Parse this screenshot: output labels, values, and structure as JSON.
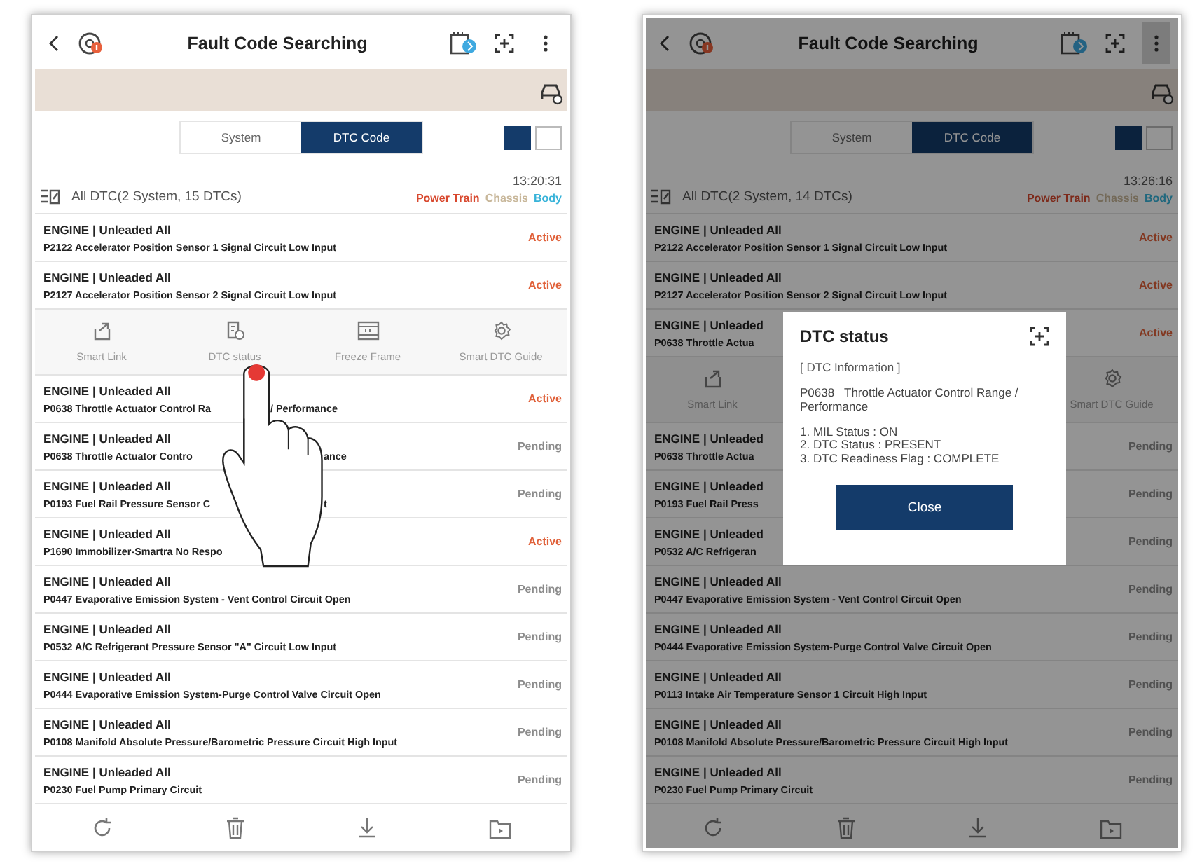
{
  "screens": [
    {
      "title": "Fault Code Searching",
      "menu_pressed": false,
      "tabs": [
        {
          "label": "System",
          "selected": false
        },
        {
          "label": "DTC Code",
          "selected": true
        }
      ],
      "view_toggle": [
        {
          "selected": true
        },
        {
          "selected": false
        }
      ],
      "summary": {
        "label": "All DTC(2 System, 15 DTCs)",
        "time": "13:20:31"
      },
      "categories": [
        {
          "label": "Power Train",
          "color": "#d8482e"
        },
        {
          "label": "Chassis",
          "color": "#c8b79a"
        },
        {
          "label": "Body",
          "color": "#38b3d9"
        }
      ],
      "list": [
        {
          "kind": "dtc",
          "heading": "ENGINE | Unleaded All",
          "description": [
            "P2122 Accelerator Position Sensor 1 Signal Circuit Low Input"
          ],
          "status": "Active",
          "active": true
        },
        {
          "kind": "dtc",
          "heading": "ENGINE | Unleaded All",
          "description": [
            "P2127 Accelerator Position Sensor 2 Signal Circuit Low Input"
          ],
          "status": "Active",
          "active": true
        },
        {
          "kind": "actions",
          "items": [
            {
              "kind": "smart_link",
              "label": "Smart Link"
            },
            {
              "kind": "dtc_status",
              "label": "DTC status"
            },
            {
              "kind": "freeze_frame",
              "label": "Freeze Frame"
            },
            {
              "kind": "guide",
              "label": "Smart DTC Guide"
            }
          ]
        },
        {
          "kind": "dtc",
          "heading": "ENGINE | Unleaded All",
          "description": [
            "P0638 Throttle Actuator Control Ra",
            "/ Performance"
          ],
          "status": "Active",
          "active": true
        },
        {
          "kind": "dtc",
          "heading": "ENGINE | Unleaded All",
          "description": [
            "P0638 Throttle Actuator Contro",
            "ance"
          ],
          "status": "Pending",
          "active": false
        },
        {
          "kind": "dtc",
          "heading": "ENGINE | Unleaded All",
          "description": [
            "P0193 Fuel Rail Pressure Sensor C",
            "t"
          ],
          "status": "Pending",
          "active": false
        },
        {
          "kind": "dtc",
          "heading": "ENGINE | Unleaded All",
          "description": [
            "P1690 Immobilizer-Smartra No Respo"
          ],
          "status": "Active",
          "active": true
        },
        {
          "kind": "dtc",
          "heading": "ENGINE | Unleaded All",
          "description": [
            "P0447 Evaporative Emission System - Vent Control Circuit Open"
          ],
          "status": "Pending",
          "active": false
        },
        {
          "kind": "dtc",
          "heading": "ENGINE | Unleaded All",
          "description": [
            "P0532 A/C Refrigerant Pressure Sensor \"A\" Circuit Low Input"
          ],
          "status": "Pending",
          "active": false
        },
        {
          "kind": "dtc",
          "heading": "ENGINE | Unleaded All",
          "description": [
            "P0444 Evaporative Emission System-Purge Control Valve Circuit Open"
          ],
          "status": "Pending",
          "active": false
        },
        {
          "kind": "dtc",
          "heading": "ENGINE | Unleaded All",
          "description": [
            "P0108 Manifold Absolute Pressure/Barometric Pressure Circuit High Input"
          ],
          "status": "Pending",
          "active": false
        },
        {
          "kind": "dtc",
          "heading": "ENGINE | Unleaded All",
          "description": [
            "P0230 Fuel Pump Primary Circuit"
          ],
          "status": "Pending",
          "active": false
        }
      ],
      "overlay": {
        "kind": "touch"
      }
    },
    {
      "title": "Fault Code Searching",
      "menu_pressed": true,
      "tabs": [
        {
          "label": "System",
          "selected": false
        },
        {
          "label": "DTC Code",
          "selected": true
        }
      ],
      "view_toggle": [
        {
          "selected": true
        },
        {
          "selected": false
        }
      ],
      "summary": {
        "label": "All DTC(2 System, 14 DTCs)",
        "time": "13:26:16"
      },
      "categories": [
        {
          "label": "Power Train",
          "color": "#7d2a1b"
        },
        {
          "label": "Chassis",
          "color": "#746a59"
        },
        {
          "label": "Body",
          "color": "#20687e"
        }
      ],
      "list": [
        {
          "kind": "dtc",
          "heading": "ENGINE | Unleaded All",
          "description": [
            "P2122 Accelerator Position Sensor 1 Signal Circuit Low Input"
          ],
          "status": "Active",
          "active": true
        },
        {
          "kind": "dtc",
          "heading": "ENGINE | Unleaded All",
          "description": [
            "P2127 Accelerator Position Sensor 2 Signal Circuit Low Input"
          ],
          "status": "Active",
          "active": true
        },
        {
          "kind": "dtc",
          "heading": "ENGINE | Unleaded",
          "description": [
            "P0638 Throttle Actua"
          ],
          "status": "Active",
          "active": true
        },
        {
          "kind": "actions",
          "items": [
            {
              "kind": "smart_link",
              "label": "Smart Link"
            },
            {
              "kind": "guide",
              "label": "Smart DTC Guide"
            }
          ]
        },
        {
          "kind": "dtc",
          "heading": "ENGINE | Unleaded",
          "description": [
            "P0638 Throttle Actua"
          ],
          "status": "Pending",
          "active": false
        },
        {
          "kind": "dtc",
          "heading": "ENGINE | Unleaded",
          "description": [
            "P0193 Fuel Rail Press"
          ],
          "status": "Pending",
          "active": false
        },
        {
          "kind": "dtc",
          "heading": "ENGINE | Unleaded",
          "description": [
            "P0532 A/C Refrigeran"
          ],
          "status": "Pending",
          "active": false
        },
        {
          "kind": "dtc",
          "heading": "ENGINE | Unleaded All",
          "description": [
            "P0447 Evaporative Emission System - Vent Control Circuit Open"
          ],
          "status": "Pending",
          "active": false
        },
        {
          "kind": "dtc",
          "heading": "ENGINE | Unleaded All",
          "description": [
            "P0444 Evaporative Emission System-Purge Control Valve Circuit Open"
          ],
          "status": "Pending",
          "active": false
        },
        {
          "kind": "dtc",
          "heading": "ENGINE | Unleaded All",
          "description": [
            "P0113 Intake Air Temperature Sensor 1 Circuit High Input"
          ],
          "status": "Pending",
          "active": false
        },
        {
          "kind": "dtc",
          "heading": "ENGINE | Unleaded All",
          "description": [
            "P0108 Manifold Absolute Pressure/Barometric Pressure Circuit High Input"
          ],
          "status": "Pending",
          "active": false
        },
        {
          "kind": "dtc",
          "heading": "ENGINE | Unleaded All",
          "description": [
            "P0230 Fuel Pump Primary Circuit"
          ],
          "status": "Pending",
          "active": false
        }
      ],
      "overlay": {
        "kind": "dialog",
        "title": "DTC status",
        "section": "[ DTC Information ]",
        "text": "P0638   Throttle Actuator Control Range / Performance",
        "details": [
          "1. MIL Status : ON",
          "2. DTC Status : PRESENT",
          "3. DTC Readiness Flag : COMPLETE"
        ],
        "button": "Close"
      }
    }
  ]
}
